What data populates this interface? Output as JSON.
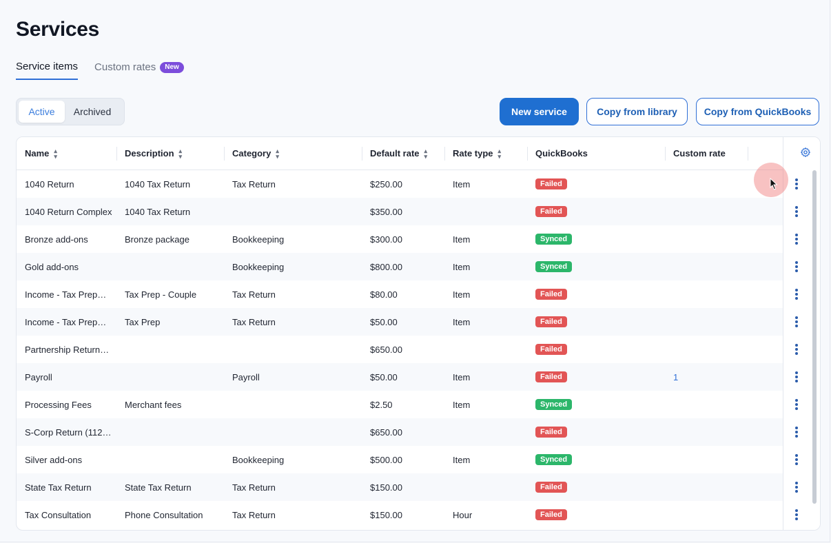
{
  "page": {
    "title": "Services"
  },
  "tabs": [
    {
      "label": "Service items",
      "active": true
    },
    {
      "label": "Custom rates",
      "badge": "New",
      "active": false
    }
  ],
  "filter": {
    "options": [
      "Active",
      "Archived"
    ],
    "selected": "Active"
  },
  "actions": {
    "new_service": "New service",
    "copy_library": "Copy from library",
    "copy_quickbooks": "Copy from QuickBooks"
  },
  "table": {
    "columns": [
      "Name",
      "Description",
      "Category",
      "Default rate",
      "Rate type",
      "QuickBooks",
      "Custom rate"
    ],
    "rows": [
      {
        "name": "1040 Return",
        "description": "1040 Tax Return",
        "category": "Tax Return",
        "default_rate": "$250.00",
        "rate_type": "Item",
        "quickbooks": "Failed",
        "custom_rate": ""
      },
      {
        "name": "1040 Return Complex",
        "description": "1040 Tax Return",
        "category": "",
        "default_rate": "$350.00",
        "rate_type": "",
        "quickbooks": "Failed",
        "custom_rate": ""
      },
      {
        "name": "Bronze add-ons",
        "description": "Bronze package",
        "category": "Bookkeeping",
        "default_rate": "$300.00",
        "rate_type": "Item",
        "quickbooks": "Synced",
        "custom_rate": ""
      },
      {
        "name": "Gold add-ons",
        "description": "",
        "category": "Bookkeeping",
        "default_rate": "$800.00",
        "rate_type": "Item",
        "quickbooks": "Synced",
        "custom_rate": ""
      },
      {
        "name": "Income - Tax Prep…",
        "description": "Tax Prep - Couple",
        "category": "Tax Return",
        "default_rate": "$80.00",
        "rate_type": "Item",
        "quickbooks": "Failed",
        "custom_rate": ""
      },
      {
        "name": "Income - Tax Prep…",
        "description": "Tax Prep",
        "category": "Tax Return",
        "default_rate": "$50.00",
        "rate_type": "Item",
        "quickbooks": "Failed",
        "custom_rate": ""
      },
      {
        "name": "Partnership Return…",
        "description": "",
        "category": "",
        "default_rate": "$650.00",
        "rate_type": "",
        "quickbooks": "Failed",
        "custom_rate": ""
      },
      {
        "name": "Payroll",
        "description": "",
        "category": "Payroll",
        "default_rate": "$50.00",
        "rate_type": "Item",
        "quickbooks": "Failed",
        "custom_rate": "1"
      },
      {
        "name": "Processing Fees",
        "description": "Merchant fees",
        "category": "",
        "default_rate": "$2.50",
        "rate_type": "Item",
        "quickbooks": "Synced",
        "custom_rate": ""
      },
      {
        "name": "S-Corp Return (112…",
        "description": "",
        "category": "",
        "default_rate": "$650.00",
        "rate_type": "",
        "quickbooks": "Failed",
        "custom_rate": ""
      },
      {
        "name": "Silver add-ons",
        "description": "",
        "category": "Bookkeeping",
        "default_rate": "$500.00",
        "rate_type": "Item",
        "quickbooks": "Synced",
        "custom_rate": ""
      },
      {
        "name": "State Tax Return",
        "description": "State Tax Return",
        "category": "Tax Return",
        "default_rate": "$150.00",
        "rate_type": "",
        "quickbooks": "Failed",
        "custom_rate": ""
      },
      {
        "name": "Tax Consultation",
        "description": "Phone Consultation",
        "category": "Tax Return",
        "default_rate": "$150.00",
        "rate_type": "Hour",
        "quickbooks": "Failed",
        "custom_rate": ""
      }
    ]
  },
  "icons": {
    "sort": "sort-icon",
    "settings": "gear-icon",
    "row_menu": "kebab-menu-icon",
    "cursor": "mouse-pointer-icon"
  },
  "colors": {
    "primary": "#1f6fd1",
    "failed": "#e25555",
    "synced": "#2cb66a",
    "badge": "#7c4ddb"
  }
}
